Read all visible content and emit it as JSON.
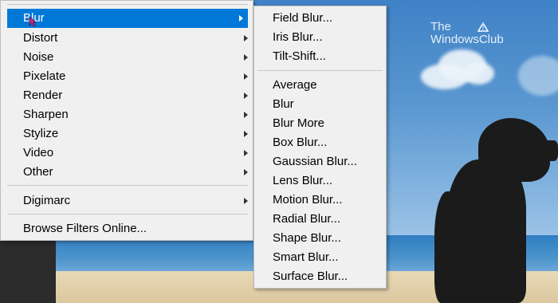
{
  "main_menu": {
    "items": [
      {
        "label": "Blur",
        "highlighted": true
      },
      {
        "label": "Distort"
      },
      {
        "label": "Noise"
      },
      {
        "label": "Pixelate"
      },
      {
        "label": "Render"
      },
      {
        "label": "Sharpen"
      },
      {
        "label": "Stylize"
      },
      {
        "label": "Video"
      },
      {
        "label": "Other"
      }
    ],
    "digimarc_label": "Digimarc",
    "browse_label": "Browse Filters Online..."
  },
  "blur_submenu": {
    "group1": [
      "Field Blur...",
      "Iris Blur...",
      "Tilt-Shift..."
    ],
    "group2": [
      "Average",
      "Blur",
      "Blur More",
      "Box Blur...",
      "Gaussian Blur...",
      "Lens Blur...",
      "Motion Blur...",
      "Radial Blur...",
      "Shape Blur...",
      "Smart Blur...",
      "Surface Blur..."
    ]
  },
  "watermark": {
    "line1": "The",
    "line2": "WindowsClub"
  },
  "colors": {
    "highlight": "#0078d7",
    "menu_bg": "#f0f0f0"
  }
}
